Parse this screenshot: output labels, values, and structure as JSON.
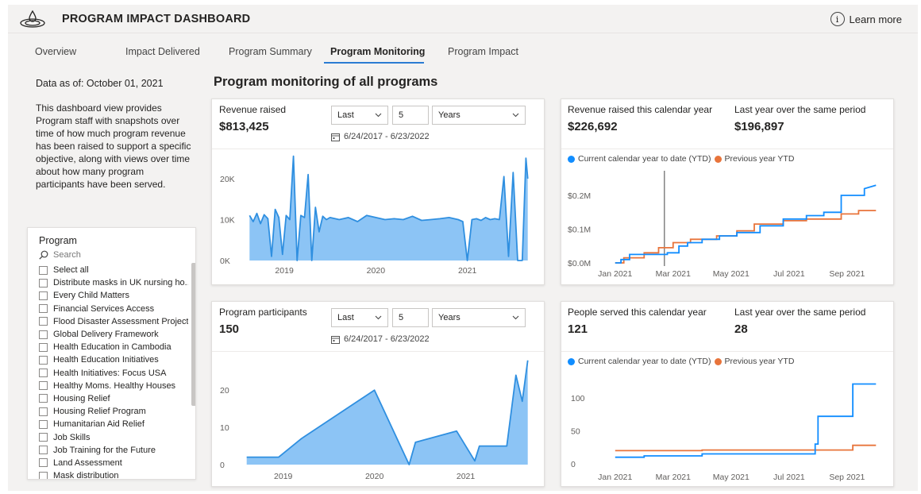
{
  "header": {
    "title": "PROGRAM IMPACT DASHBOARD",
    "learn_more": "Learn more",
    "logo_icon": "droplet-ripple-icon",
    "info_icon": "info-icon"
  },
  "tabs": [
    {
      "label": "Overview"
    },
    {
      "label": "Impact Delivered"
    },
    {
      "label": "Program Summary"
    },
    {
      "label": "Program Monitoring",
      "active": true
    },
    {
      "label": "Program Impact"
    }
  ],
  "left": {
    "data_as_of": "Data as of: October 01, 2021",
    "description": "This dashboard view provides Program staff with snapshots over time of how much program revenue has been raised to support a specific objective, along with views over time about how many program participants have been served."
  },
  "page_title": "Program monitoring of all programs",
  "slicer": {
    "title": "Program",
    "search_placeholder": "Search",
    "items": [
      "Select all",
      "Distribute masks in UK nursing ho...",
      "Every Child Matters",
      "Financial Services Access",
      "Flood Disaster Assessment Project",
      "Global Delivery Framework",
      "Health Education in Cambodia",
      "Health Education Initiatives",
      "Health Initiatives: Focus USA",
      "Healthy Moms. Healthy Houses",
      "Housing Relief",
      "Housing Relief Program",
      "Humanitarian Aid Relief",
      "Job Skills",
      "Job Training for the Future",
      "Land Assessment",
      "Mask distribution"
    ]
  },
  "revenue_card": {
    "label": "Revenue raised",
    "value": "$813,425",
    "filter_mode": "Last",
    "filter_count": "5",
    "filter_unit": "Years",
    "range": "6/24/2017 - 6/23/2022"
  },
  "participants_card": {
    "label": "Program participants",
    "value": "150",
    "filter_mode": "Last",
    "filter_count": "5",
    "filter_unit": "Years",
    "range": "6/24/2017 - 6/23/2022"
  },
  "revenue_ytd_card": {
    "label": "Revenue raised this calendar year",
    "value": "$226,692",
    "prev_label": "Last year over the same period",
    "prev_value": "$196,897"
  },
  "people_ytd_card": {
    "label": "People served this calendar year",
    "value": "121",
    "prev_label": "Last year over the same period",
    "prev_value": "28"
  },
  "legend": {
    "current": "Current calendar year to date (YTD)",
    "previous": "Previous year YTD"
  },
  "colors": {
    "accent": "#2b7cd3",
    "area_fill": "#8cc4f5",
    "area_line": "#2f8fe0",
    "current": "#118dff",
    "previous": "#e8743b",
    "tab_underline": "#2b7cd3"
  },
  "chart_data": [
    {
      "id": "revenue_area",
      "type": "area",
      "x_ticks": [
        "2019",
        "2020",
        "2021"
      ],
      "x_tick_pos": [
        2019.0,
        2020.0,
        2021.0
      ],
      "y_ticks": [
        "0K",
        "10K",
        "20K"
      ],
      "y_tick_vals": [
        0,
        10000,
        20000
      ],
      "ylim": [
        0,
        26000
      ],
      "xlim": [
        2018.6,
        2021.68
      ],
      "x": [
        2018.62,
        2018.66,
        2018.7,
        2018.74,
        2018.78,
        2018.82,
        2018.86,
        2018.9,
        2018.94,
        2018.98,
        2019.02,
        2019.06,
        2019.1,
        2019.14,
        2019.18,
        2019.22,
        2019.26,
        2019.3,
        2019.34,
        2019.38,
        2019.42,
        2019.46,
        2019.5,
        2019.6,
        2019.7,
        2019.8,
        2019.9,
        2020.0,
        2020.1,
        2020.2,
        2020.3,
        2020.4,
        2020.5,
        2020.6,
        2020.7,
        2020.8,
        2020.9,
        2020.95,
        2021.0,
        2021.05,
        2021.1,
        2021.15,
        2021.2,
        2021.25,
        2021.3,
        2021.35,
        2021.4,
        2021.45,
        2021.5,
        2021.55,
        2021.6,
        2021.64,
        2021.66
      ],
      "values": [
        11000,
        9500,
        11500,
        9000,
        11200,
        10200,
        1000,
        12500,
        10500,
        1500,
        11000,
        10000,
        25500,
        0,
        11000,
        10500,
        21000,
        0,
        13000,
        7000,
        10800,
        10000,
        10500,
        10000,
        10500,
        9500,
        11000,
        10500,
        10000,
        10200,
        10000,
        10800,
        9800,
        10000,
        10200,
        10500,
        10000,
        9500,
        0,
        10000,
        10200,
        9800,
        10500,
        10000,
        10200,
        10000,
        20500,
        1000,
        21500,
        0,
        0,
        25000,
        20000
      ]
    },
    {
      "id": "revenue_ytd",
      "type": "line",
      "x_ticks": [
        "Jan 2021",
        "Mar 2021",
        "May 2021",
        "Jul 2021",
        "Sep 2021"
      ],
      "x_tick_pos": [
        0,
        2,
        4,
        6,
        8
      ],
      "y_ticks": [
        "$0.0M",
        "$0.1M",
        "$0.2M"
      ],
      "y_tick_vals": [
        0,
        0.1,
        0.2
      ],
      "ylim": [
        0,
        0.24
      ],
      "xlim": [
        -0.35,
        9.1
      ],
      "series": [
        {
          "name": "Current calendar year to date (YTD)",
          "color": "#118dff",
          "x": [
            0,
            0.2,
            0.2,
            0.5,
            0.5,
            1.8,
            1.8,
            2.2,
            2.2,
            2.5,
            2.5,
            3.0,
            3.0,
            3.6,
            3.6,
            4.2,
            4.2,
            5.0,
            5.0,
            5.8,
            5.8,
            6.6,
            6.6,
            7.2,
            7.2,
            7.8,
            7.8,
            8.6,
            8.6,
            9.0
          ],
          "y": [
            0,
            0,
            0.01,
            0.01,
            0.025,
            0.025,
            0.03,
            0.03,
            0.05,
            0.05,
            0.06,
            0.06,
            0.07,
            0.07,
            0.08,
            0.08,
            0.09,
            0.09,
            0.11,
            0.11,
            0.13,
            0.13,
            0.14,
            0.14,
            0.15,
            0.15,
            0.2,
            0.2,
            0.22,
            0.23
          ]
        },
        {
          "name": "Previous year YTD",
          "color": "#e8743b",
          "x": [
            0,
            0.3,
            0.3,
            1.0,
            1.0,
            1.5,
            1.5,
            2.0,
            2.0,
            2.6,
            2.6,
            3.5,
            3.5,
            4.2,
            4.2,
            4.8,
            4.8,
            5.8,
            5.8,
            6.6,
            6.6,
            7.8,
            7.8,
            8.4,
            8.4,
            9.0
          ],
          "y": [
            0,
            0,
            0.015,
            0.015,
            0.03,
            0.03,
            0.045,
            0.045,
            0.06,
            0.06,
            0.07,
            0.07,
            0.08,
            0.08,
            0.095,
            0.095,
            0.115,
            0.115,
            0.125,
            0.125,
            0.13,
            0.13,
            0.145,
            0.145,
            0.155,
            0.155
          ]
        }
      ],
      "cursor_x": 1.7
    },
    {
      "id": "participants_area",
      "type": "area",
      "x_ticks": [
        "2019",
        "2020",
        "2021"
      ],
      "x_tick_pos": [
        2019.0,
        2020.0,
        2021.0
      ],
      "y_ticks": [
        "0",
        "10",
        "20"
      ],
      "y_tick_vals": [
        0,
        10,
        20
      ],
      "ylim": [
        0,
        29
      ],
      "xlim": [
        2018.55,
        2021.7
      ],
      "x": [
        2018.6,
        2018.95,
        2019.2,
        2020.0,
        2020.38,
        2020.45,
        2020.9,
        2021.1,
        2021.15,
        2021.45,
        2021.55,
        2021.62,
        2021.68
      ],
      "values": [
        2,
        2,
        7,
        20,
        0,
        6,
        9,
        1,
        5,
        5,
        24,
        17,
        28
      ]
    },
    {
      "id": "people_ytd",
      "type": "line",
      "x_ticks": [
        "Jan 2021",
        "Mar 2021",
        "May 2021",
        "Jul 2021",
        "Sep 2021"
      ],
      "x_tick_pos": [
        0,
        2,
        4,
        6,
        8
      ],
      "y_ticks": [
        "0",
        "50",
        "100"
      ],
      "y_tick_vals": [
        0,
        50,
        100
      ],
      "ylim": [
        0,
        130
      ],
      "xlim": [
        -0.35,
        9.1
      ],
      "series": [
        {
          "name": "Current calendar year to date (YTD)",
          "color": "#118dff",
          "x": [
            0,
            1.0,
            1.0,
            3.0,
            3.0,
            6.9,
            6.9,
            7.0,
            7.0,
            8.2,
            8.2,
            9.0
          ],
          "y": [
            10,
            10,
            12,
            12,
            15,
            15,
            30,
            30,
            72,
            72,
            121,
            121
          ]
        },
        {
          "name": "Previous year YTD",
          "color": "#e8743b",
          "x": [
            0,
            3.0,
            3.0,
            8.2,
            8.2,
            9.0
          ],
          "y": [
            20,
            20,
            21,
            21,
            28,
            28
          ]
        }
      ]
    }
  ]
}
